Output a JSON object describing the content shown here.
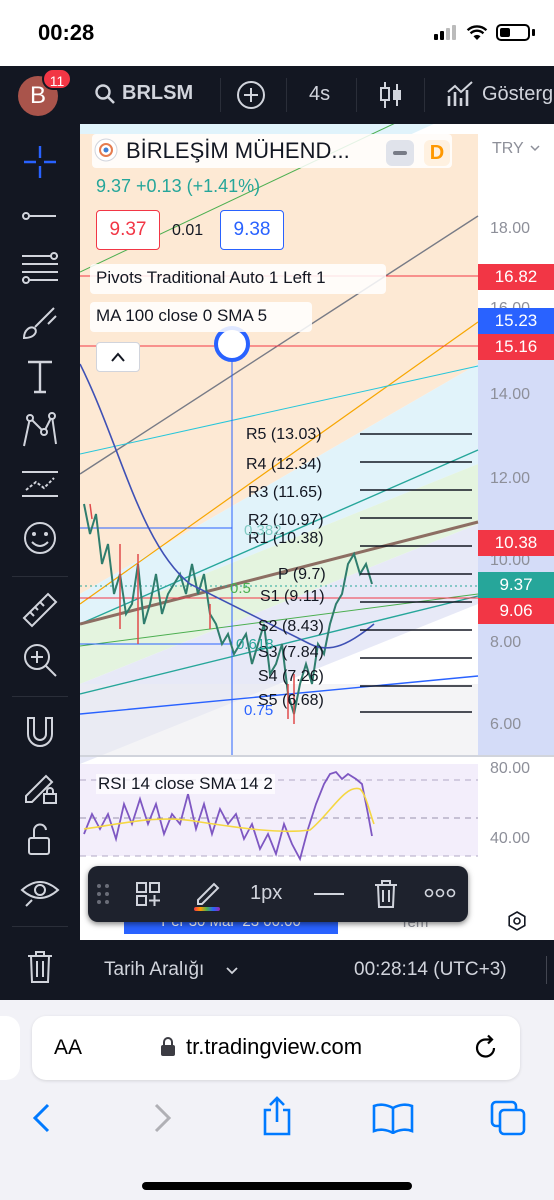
{
  "status_bar": {
    "time": "00:28"
  },
  "toolbar": {
    "avatar_letter": "B",
    "notification_count": "11",
    "symbol": "BRLSM",
    "interval": "4s",
    "indicators_label": "Gösterg"
  },
  "legend": {
    "name": "BİRLEŞİM MÜHEND...",
    "timeframe": "D",
    "price_line": "9.37 +0.13 (+1.41%)",
    "bid": "9.37",
    "spread": "0.01",
    "ask": "9.38",
    "pivots_label": "Pivots Traditional Auto 1 Left 1",
    "ma_label": "MA 100 close 0 SMA 5",
    "rsi_label": "RSI 14 close SMA 14 2"
  },
  "price_axis": {
    "currency": "TRY",
    "ticks": [
      "18.00",
      "16.00",
      "14.00",
      "12.00",
      "10.00",
      "8.00",
      "6.00"
    ],
    "rsi_ticks": [
      "80.00",
      "40.00"
    ]
  },
  "price_tags": [
    {
      "label": "16.82",
      "color": "#f23645"
    },
    {
      "label": "15.23",
      "color": "#2962ff"
    },
    {
      "label": "15.16",
      "color": "#f23645"
    },
    {
      "label": "10.38",
      "color": "#f23645"
    },
    {
      "label": "9.37",
      "color": "#26a69a"
    },
    {
      "label": "9.06",
      "color": "#f23645"
    }
  ],
  "pivots": [
    {
      "label": "R5 (13.03)"
    },
    {
      "label": "R4 (12.34)"
    },
    {
      "label": "R3 (11.65)"
    },
    {
      "label": "R2 (10.97)"
    },
    {
      "label": "R1 (10.38)"
    },
    {
      "label": "P (9.7)"
    },
    {
      "label": "S1 (9.11)"
    },
    {
      "label": "S2 (8.43)"
    },
    {
      "label": "S3 (7.84)"
    },
    {
      "label": "S4 (7.26)"
    },
    {
      "label": "S5 (6.68)"
    }
  ],
  "fib_labels": [
    "0.382",
    "0.5",
    "0.618",
    "0.75"
  ],
  "drawing_toolbar": {
    "width_label": "1px"
  },
  "time_axis": {
    "date_label": "Per 30 Mar '23 00:00",
    "month_label": "Tem"
  },
  "bottom_bar": {
    "range_label": "Tarih Aralığı",
    "clock": "00:28:14 (UTC+3)"
  },
  "browser": {
    "text_size": "AA",
    "url": "tr.tradingview.com"
  }
}
